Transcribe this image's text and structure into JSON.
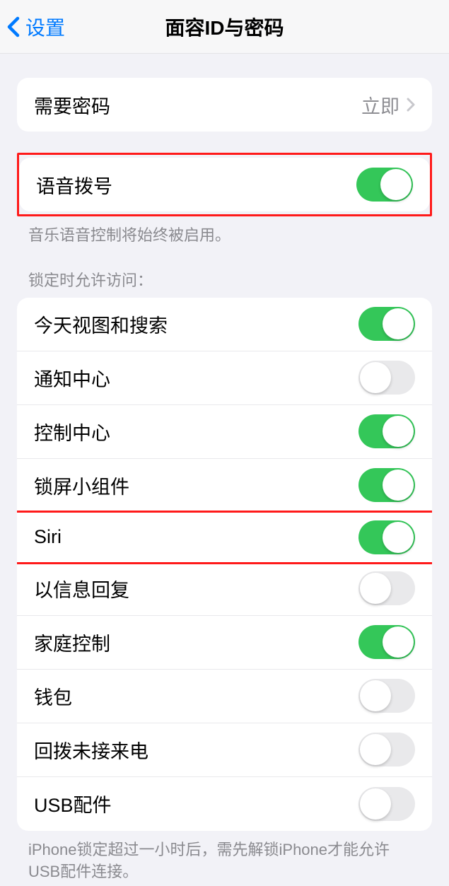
{
  "nav": {
    "back_label": "设置",
    "title": "面容ID与密码"
  },
  "require_passcode": {
    "label": "需要密码",
    "value": "立即"
  },
  "voice_dial": {
    "label": "语音拨号",
    "footer": "音乐语音控制将始终被启用。",
    "on": true
  },
  "lock_access": {
    "header": "锁定时允许访问：",
    "items": [
      {
        "label": "今天视图和搜索",
        "on": true
      },
      {
        "label": "通知中心",
        "on": false
      },
      {
        "label": "控制中心",
        "on": true
      },
      {
        "label": "锁屏小组件",
        "on": true
      },
      {
        "label": "Siri",
        "on": true
      },
      {
        "label": "以信息回复",
        "on": false
      },
      {
        "label": "家庭控制",
        "on": true
      },
      {
        "label": "钱包",
        "on": false
      },
      {
        "label": "回拨未接来电",
        "on": false
      },
      {
        "label": "USB配件",
        "on": false
      }
    ],
    "footer": "iPhone锁定超过一小时后，需先解锁iPhone才能允许USB配件连接。"
  }
}
